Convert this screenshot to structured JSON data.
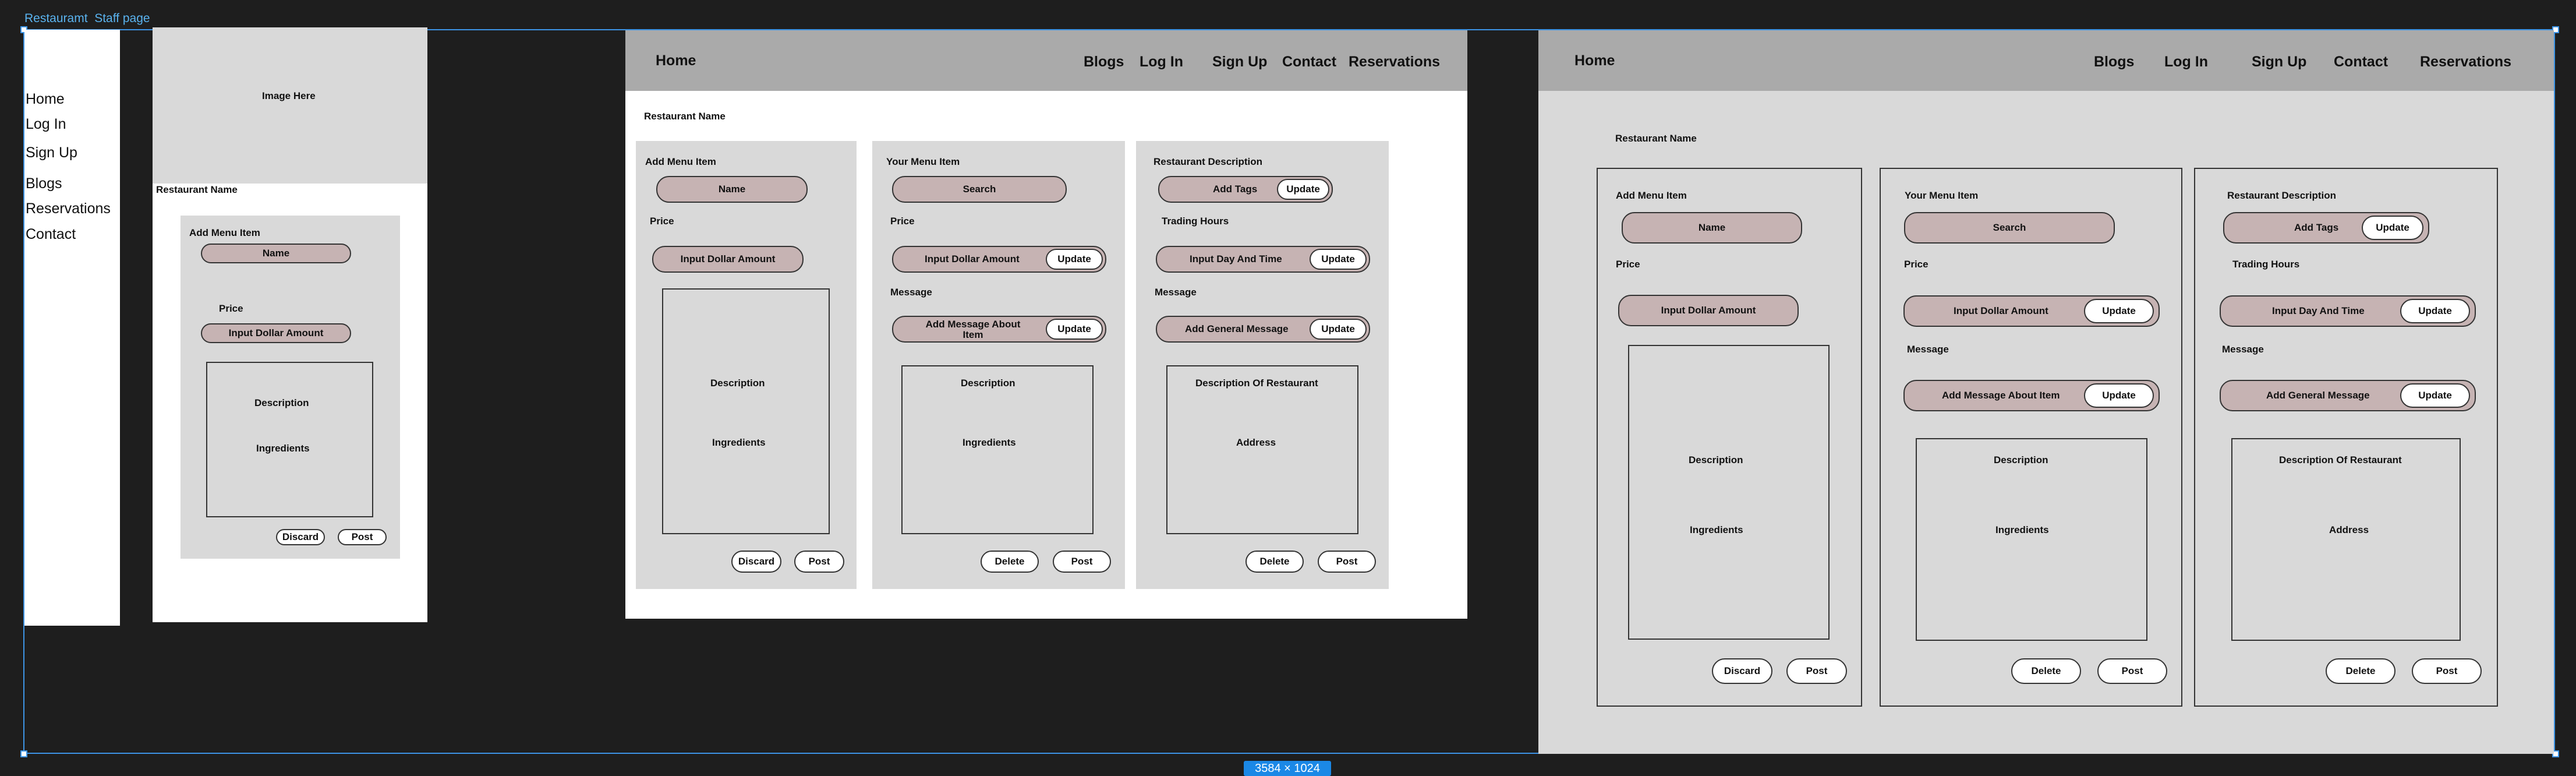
{
  "canvas": {
    "frame_title": "Restauramt  Staff page",
    "size_badge": "3584 × 1024",
    "colors": {
      "canvas": "#1e1e1e",
      "selection": "#3d94e6",
      "nav": "#aaaaaa",
      "card": "#d9d9d9",
      "pill": "#c6b3b3"
    }
  },
  "mobile_menu": {
    "items": [
      "Home",
      "Log In",
      "Sign Up",
      "Blogs",
      "Reservations",
      "Contact"
    ]
  },
  "mobile_page": {
    "image_placeholder": "Image Here",
    "restaurant_name": "Restaurant Name",
    "card": {
      "title": "Add Menu Item",
      "name_pill": "Name",
      "price_label": "Price",
      "price_pill": "Input Dollar Amount",
      "box_line1": "Description",
      "box_line2": "Ingredients",
      "discard": "Discard",
      "post": "Post"
    }
  },
  "tablet_page": {
    "nav": {
      "home": "Home",
      "links": [
        "Blogs",
        "Log In",
        "Sign Up",
        "Contact",
        "Reservations"
      ]
    },
    "restaurant_name": "Restaurant Name",
    "add_card": {
      "title": "Add Menu Item",
      "name_pill": "Name",
      "price_label": "Price",
      "price_pill": "Input Dollar Amount",
      "box_line1": "Description",
      "box_line2": "Ingredients",
      "discard": "Discard",
      "post": "Post"
    },
    "menu_card": {
      "title": "Your Menu Item",
      "search_pill": "Search",
      "price_label": "Price",
      "price_pill": "Input Dollar Amount",
      "update": "Update",
      "message_label": "Message",
      "message_pill": "Add Message About Item",
      "box_line1": "Description",
      "box_line2": "Ingredients",
      "delete": "Delete",
      "post": "Post"
    },
    "desc_card": {
      "title": "Restaurant Description",
      "tags_pill": "Add Tags",
      "update": "Update",
      "hours_label": "Trading Hours",
      "hours_pill": "Input Day And Time",
      "message_label": "Message",
      "message_pill": "Add General Message",
      "box_line1": "Description Of Restaurant",
      "box_line2": "Address",
      "delete": "Delete",
      "post": "Post"
    }
  },
  "desktop_page": {
    "nav": {
      "home": "Home",
      "links": [
        "Blogs",
        "Log In",
        "Sign Up",
        "Contact",
        "Reservations"
      ]
    },
    "restaurant_name": "Restaurant Name",
    "add_card": {
      "title": "Add Menu Item",
      "name_pill": "Name",
      "price_label": "Price",
      "price_pill": "Input Dollar Amount",
      "box_line1": "Description",
      "box_line2": "Ingredients",
      "discard": "Discard",
      "post": "Post"
    },
    "menu_card": {
      "title": "Your Menu Item",
      "search_pill": "Search",
      "price_label": "Price",
      "price_pill": "Input Dollar Amount",
      "update": "Update",
      "message_label": "Message",
      "message_pill": "Add Message About Item",
      "box_line1": "Description",
      "box_line2": "Ingredients",
      "delete": "Delete",
      "post": "Post"
    },
    "desc_card": {
      "title": "Restaurant Description",
      "tags_pill": "Add Tags",
      "update": "Update",
      "hours_label": "Trading Hours",
      "hours_pill": "Input Day And Time",
      "message_label": "Message",
      "message_pill": "Add General Message",
      "box_line1": "Description Of Restaurant",
      "box_line2": "Address",
      "delete": "Delete",
      "post": "Post"
    }
  }
}
